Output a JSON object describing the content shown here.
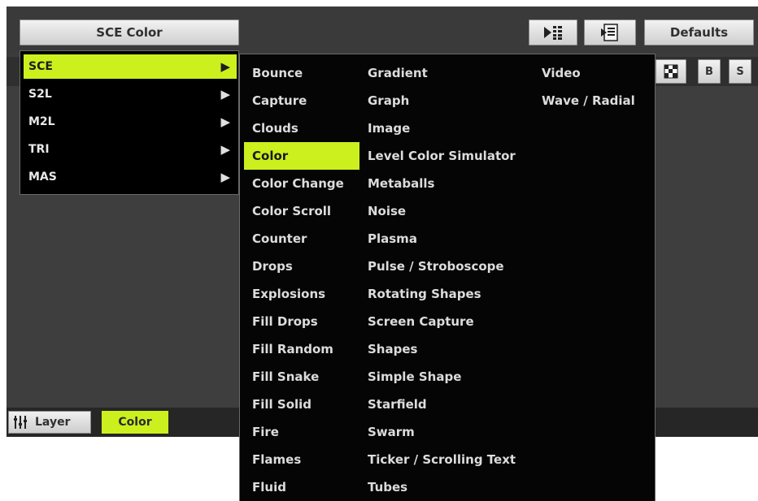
{
  "header": {
    "title_button": "SCE Color",
    "defaults_button": "Defaults",
    "toolbar_icons": [
      "play-list-icon",
      "list-page-icon"
    ],
    "small_buttons": [
      "B",
      "S"
    ]
  },
  "footer": {
    "layer_button": "Layer",
    "color_tab": "Color"
  },
  "colors": {
    "accent": "#ccf01e",
    "menu_bg": "#050505",
    "panel_bg": "#3c3c3c"
  },
  "menu_categories": [
    {
      "label": "SCE",
      "selected": true
    },
    {
      "label": "S2L",
      "selected": false
    },
    {
      "label": "M2L",
      "selected": false
    },
    {
      "label": "TRI",
      "selected": false
    },
    {
      "label": "MAS",
      "selected": false
    }
  ],
  "submenu": {
    "column1": [
      "Bounce",
      "Capture",
      "Clouds",
      "Color",
      "Color Change",
      "Color Scroll",
      "Counter",
      "Drops",
      "Explosions",
      "Fill Drops",
      "Fill Random",
      "Fill Snake",
      "Fill Solid",
      "Fire",
      "Flames",
      "Fluid"
    ],
    "column2": [
      "Gradient",
      "Graph",
      "Image",
      "Level Color Simulator",
      "Metaballs",
      "Noise",
      "Plasma",
      "Pulse / Stroboscope",
      "Rotating Shapes",
      "Screen Capture",
      "Shapes",
      "Simple Shape",
      "Starfield",
      "Swarm",
      "Ticker / Scrolling Text",
      "Tubes"
    ],
    "column3": [
      "Video",
      "Wave / Radial"
    ],
    "selected": "Color"
  }
}
